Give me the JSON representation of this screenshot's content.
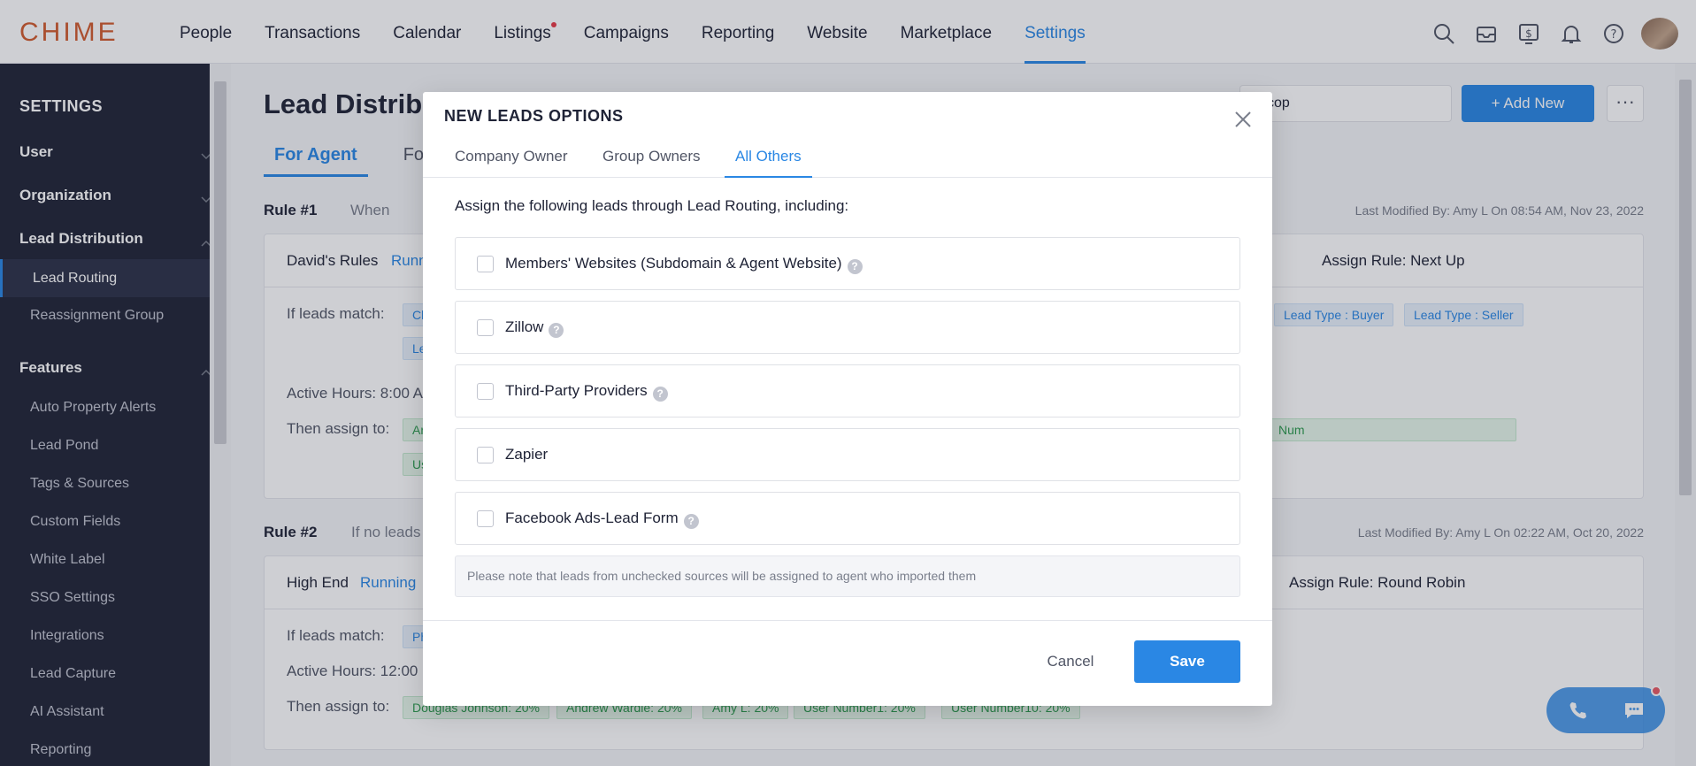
{
  "app": {
    "logo_text": "CHIME",
    "nav": [
      {
        "label": "People"
      },
      {
        "label": "Transactions"
      },
      {
        "label": "Calendar"
      },
      {
        "label": "Listings"
      },
      {
        "label": "Campaigns"
      },
      {
        "label": "Reporting"
      },
      {
        "label": "Website"
      },
      {
        "label": "Marketplace"
      },
      {
        "label": "Settings"
      }
    ]
  },
  "sidebar": {
    "title": "SETTINGS",
    "sections": [
      {
        "label": "User"
      },
      {
        "label": "Organization"
      },
      {
        "label": "Lead Distribution"
      },
      {
        "label": "Features"
      }
    ],
    "items": [
      {
        "label": "Lead Routing"
      },
      {
        "label": "Reassignment Group"
      },
      {
        "label": "Auto Property Alerts"
      },
      {
        "label": "Lead Pond"
      },
      {
        "label": "Tags & Sources"
      },
      {
        "label": "Custom Fields"
      },
      {
        "label": "White Label"
      },
      {
        "label": "SSO Settings"
      },
      {
        "label": "Integrations"
      },
      {
        "label": "Lead Capture"
      },
      {
        "label": "AI Assistant"
      },
      {
        "label": "Reporting"
      }
    ]
  },
  "main": {
    "title": "Lead Distribu",
    "tabs": [
      {
        "label": "For Agent"
      },
      {
        "label": "For"
      }
    ],
    "select_value": "cop",
    "add_new_label": "+ Add New",
    "more_label": "···",
    "rule1": {
      "label": "Rule #1",
      "when": "When",
      "last_modified": "Last Modified By: Amy L  On 08:54 AM, Nov 23, 2022",
      "name": "David's Rules",
      "status": "Runn",
      "assign_rule": "Assign Rule: Next Up",
      "if_match": "If leads match:",
      "tags": [
        "Cl",
        "Le",
        "Lead Type : Buyer",
        "Lead Type : Seller"
      ],
      "active_hours": "Active Hours: 8:00 A",
      "then_assign": "Then assign to:",
      "assign_tags": [
        "Ar",
        "Us",
        "Num"
      ]
    },
    "rule2": {
      "label": "Rule #2",
      "when": "If no leads",
      "last_modified": "Last Modified By: Amy L  On 02:22 AM, Oct 20, 2022",
      "name": "High End",
      "status": "Running",
      "assign_rule": "Assign Rule: Round Robin",
      "if_match": "If leads match:",
      "tags": [
        "Ph"
      ],
      "active_hours": "Active Hours: 12:00",
      "then_assign": "Then assign to:",
      "assign_tags": [
        "Douglas Johnson: 20%",
        "Andrew Wardle: 20%",
        "Amy L: 20%",
        "User Number1: 20%",
        "User Number10: 20%"
      ]
    }
  },
  "modal": {
    "title": "NEW LEADS OPTIONS",
    "tabs": [
      {
        "label": "Company Owner"
      },
      {
        "label": "Group Owners"
      },
      {
        "label": "All Others"
      }
    ],
    "intro": "Assign the following leads through Lead Routing, including:",
    "options": [
      {
        "label": "Members' Websites (Subdomain & Agent Website)",
        "checked": false,
        "help": "?"
      },
      {
        "label": "Zillow",
        "checked": false,
        "help": "?"
      },
      {
        "label": "Third-Party Providers",
        "checked": false,
        "help": "?"
      },
      {
        "label": "Zapier",
        "checked": false
      },
      {
        "label": "Facebook Ads-Lead Form",
        "checked": false,
        "help": "?"
      }
    ],
    "note": "Please note that leads from unchecked sources will be assigned to agent who imported them",
    "cancel_label": "Cancel",
    "save_label": "Save"
  },
  "colors": {
    "accent": "#2a87e4",
    "sidebar_bg": "#202437",
    "brand": "#d15b2e"
  }
}
